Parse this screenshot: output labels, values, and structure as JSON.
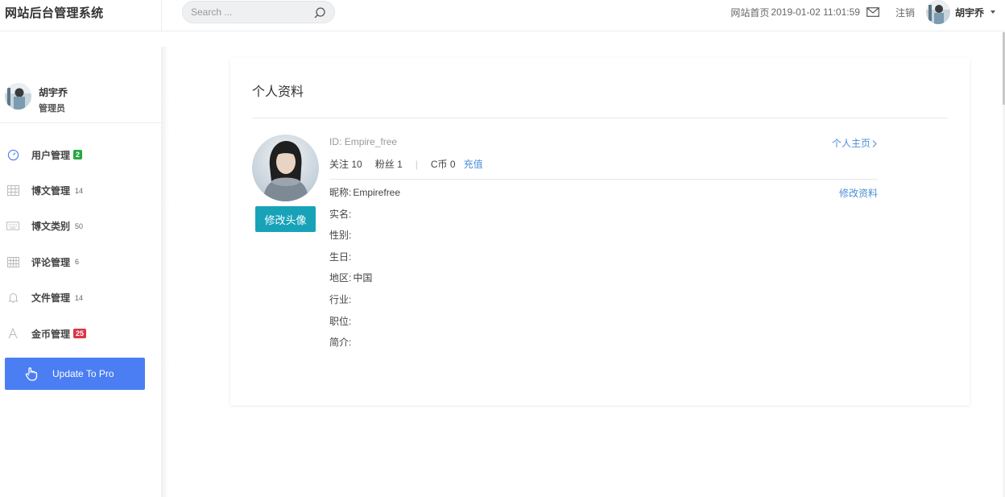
{
  "header": {
    "brand": "网站后台管理系统",
    "search_placeholder": "Search ...",
    "home_link": "网站首页",
    "datetime": "2019-01-02 11:01:59",
    "logout": "注销",
    "username": "胡宇乔"
  },
  "sidebar": {
    "user": {
      "name": "胡宇乔",
      "role": "管理员"
    },
    "items": [
      {
        "label": "用户管理",
        "icon": "speedometer-icon",
        "badge": "2",
        "badge_color": "#28a745"
      },
      {
        "label": "博文管理",
        "icon": "grid-icon",
        "count": "14"
      },
      {
        "label": "博文类别",
        "icon": "keyboard-icon",
        "count": "50"
      },
      {
        "label": "评论管理",
        "icon": "table-icon",
        "count": "6"
      },
      {
        "label": "文件管理",
        "icon": "bell-icon",
        "count": "14"
      },
      {
        "label": "金币管理",
        "icon": "letter-a-icon",
        "badge": "25",
        "badge_color": "#dc3545"
      }
    ],
    "upgrade_label": "Update To Pro"
  },
  "profile": {
    "title": "个人资料",
    "id_label": "ID:",
    "id_value": "Empire_free",
    "homepage_link": "个人主页",
    "follow_label": "关注",
    "follow_count": "10",
    "fans_label": "粉丝",
    "fans_count": "1",
    "coin_label": "C币",
    "coin_count": "0",
    "recharge_link": "充值",
    "edit_link": "修改资料",
    "change_avatar_button": "修改头像",
    "fields": [
      {
        "label": "昵称:",
        "value": "Empirefree"
      },
      {
        "label": "实名:",
        "value": ""
      },
      {
        "label": "性别:",
        "value": ""
      },
      {
        "label": "生日:",
        "value": ""
      },
      {
        "label": "地区:",
        "value": "中国"
      },
      {
        "label": "行业:",
        "value": ""
      },
      {
        "label": "职位:",
        "value": ""
      },
      {
        "label": "简介:",
        "value": ""
      }
    ]
  },
  "colors": {
    "accent_blue": "#4a7ef2",
    "link_blue": "#4a8fd8",
    "teal_button": "#17a2b8"
  }
}
